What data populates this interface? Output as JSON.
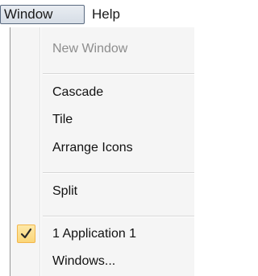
{
  "menubar": {
    "items": [
      {
        "label": "Window"
      },
      {
        "label": "Help"
      }
    ]
  },
  "menu": {
    "items": [
      {
        "label": "New Window",
        "enabled": false
      },
      {
        "label": "Cascade",
        "enabled": true
      },
      {
        "label": "Tile",
        "enabled": true
      },
      {
        "label": "Arrange Icons",
        "enabled": true
      },
      {
        "label": "Split",
        "enabled": true
      },
      {
        "label": "1 Application 1",
        "enabled": true,
        "checked": true
      },
      {
        "label": "Windows...",
        "enabled": true
      }
    ]
  },
  "colors": {
    "menu_background": "#f5f5f5",
    "check_highlight": "#fbd679",
    "check_mark": "#2a2a2a",
    "disabled_text": "#8d8d8d"
  },
  "icons": {
    "check": "checkmark-icon"
  }
}
